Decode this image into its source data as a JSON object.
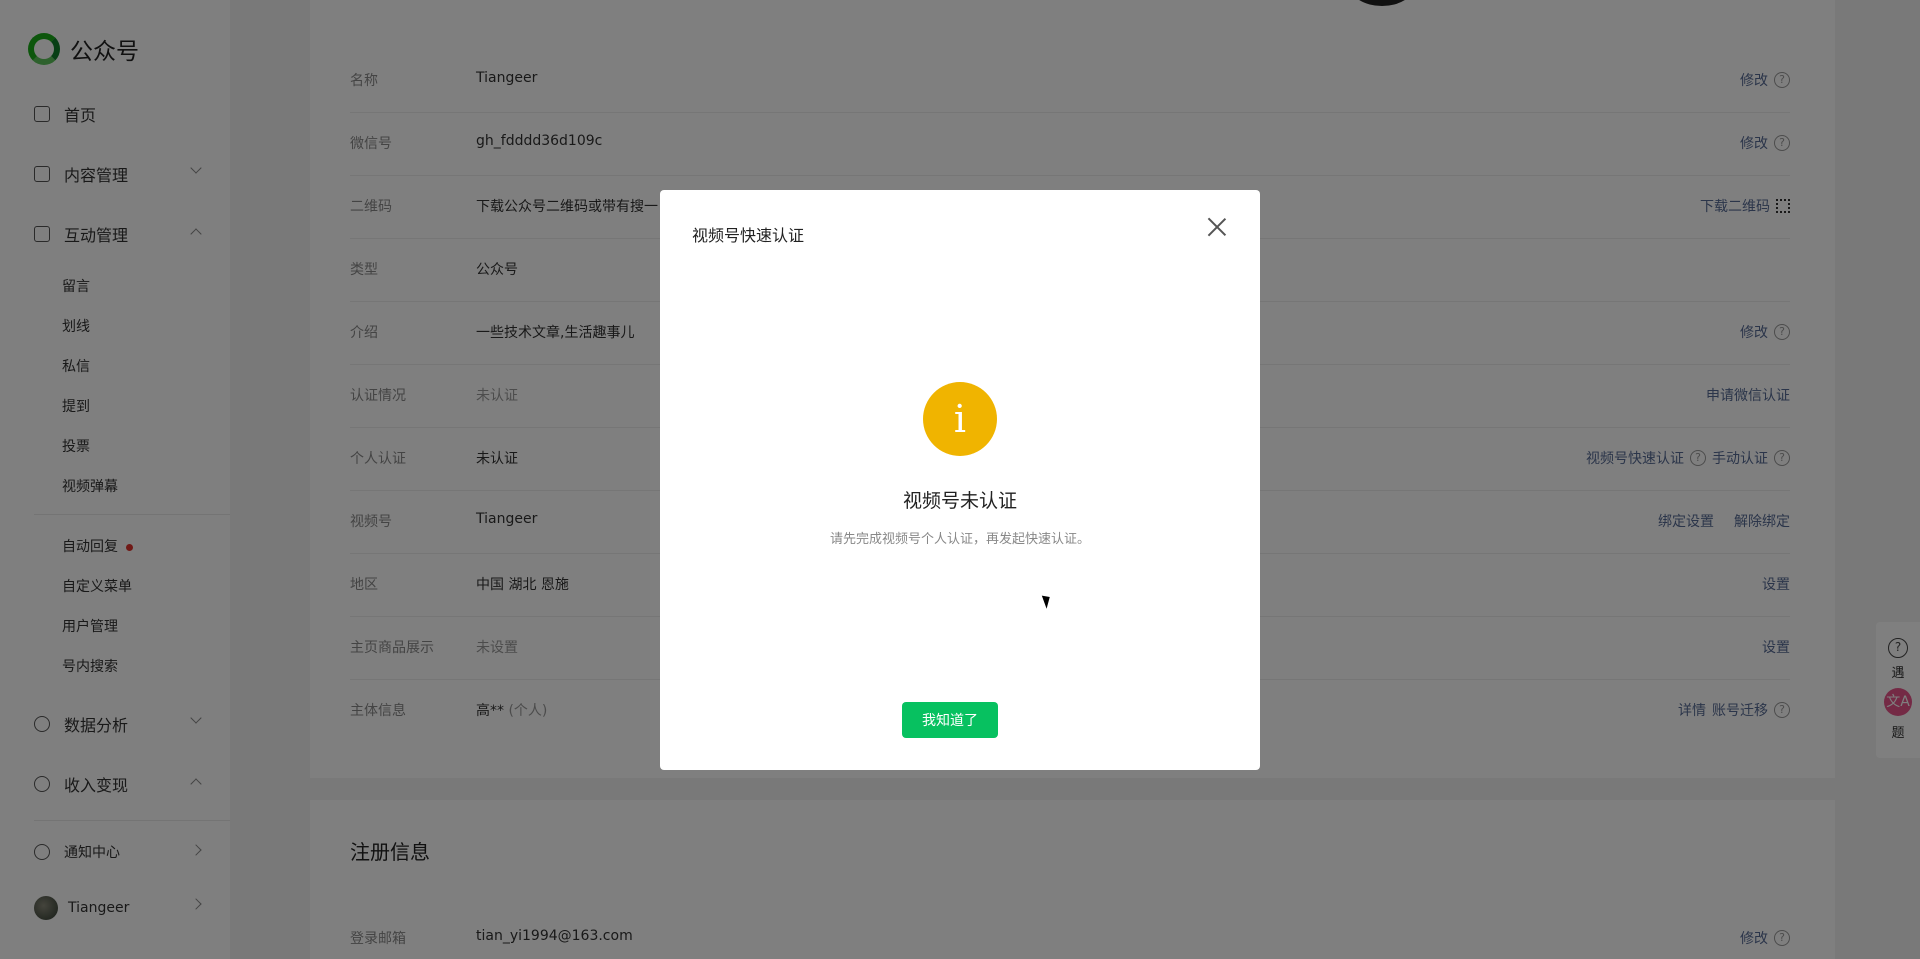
{
  "brand": {
    "name": "公众号"
  },
  "sidebar": {
    "home": "首页",
    "content_mgmt": "内容管理",
    "interaction_mgmt": "互动管理",
    "interaction_items": [
      "留言",
      "划线",
      "私信",
      "提到",
      "投票",
      "视频弹幕"
    ],
    "auto_reply": "自动回复",
    "more_items": [
      "自定义菜单",
      "用户管理",
      "号内搜索"
    ],
    "data_analysis": "数据分析",
    "revenue": "收入变现",
    "notifications": "通知中心",
    "user": "Tiangeer"
  },
  "info_rows": [
    {
      "label": "名称",
      "value": "Tiangeer",
      "action": "修改"
    },
    {
      "label": "微信号",
      "value": "gh_fdddd36d109c",
      "action": "修改"
    },
    {
      "label": "二维码",
      "value": "下载公众号二维码或带有搜一",
      "action": "下载二维码"
    },
    {
      "label": "类型",
      "value": "公众号",
      "action": ""
    },
    {
      "label": "介绍",
      "value": "一些技术文章,生活趣事儿",
      "action": "修改"
    },
    {
      "label": "认证情况",
      "value": "未认证",
      "action": "申请微信认证"
    },
    {
      "label": "个人认证",
      "value": "未认证",
      "action": "视频号快速认证",
      "action2": "手动认证"
    },
    {
      "label": "视频号",
      "value": "Tiangeer",
      "action": "绑定设置",
      "action2": "解除绑定"
    },
    {
      "label": "地区",
      "value": "中国 湖北 恩施",
      "action": "设置"
    },
    {
      "label": "主页商品展示",
      "value": "未设置",
      "action": "设置"
    },
    {
      "label": "主体信息",
      "value": "高**",
      "value_suffix": "(个人)",
      "action": "详情",
      "action2": "账号迁移"
    }
  ],
  "registration": {
    "title": "注册信息",
    "email_label": "登录邮箱",
    "email_value": "tian_yi1994@163.com",
    "email_action": "修改"
  },
  "dialog": {
    "title": "视频号快速认证",
    "icon": "i",
    "heading": "视频号未认证",
    "description": "请先完成视频号个人认证，再发起快速认证。",
    "button": "我知道了"
  },
  "help_widget": {
    "text_top": "遇",
    "badge": "文A",
    "text_bottom": "题"
  },
  "colors": {
    "accent_green": "#07c160",
    "warning": "#f0b400",
    "link": "#576b95"
  }
}
